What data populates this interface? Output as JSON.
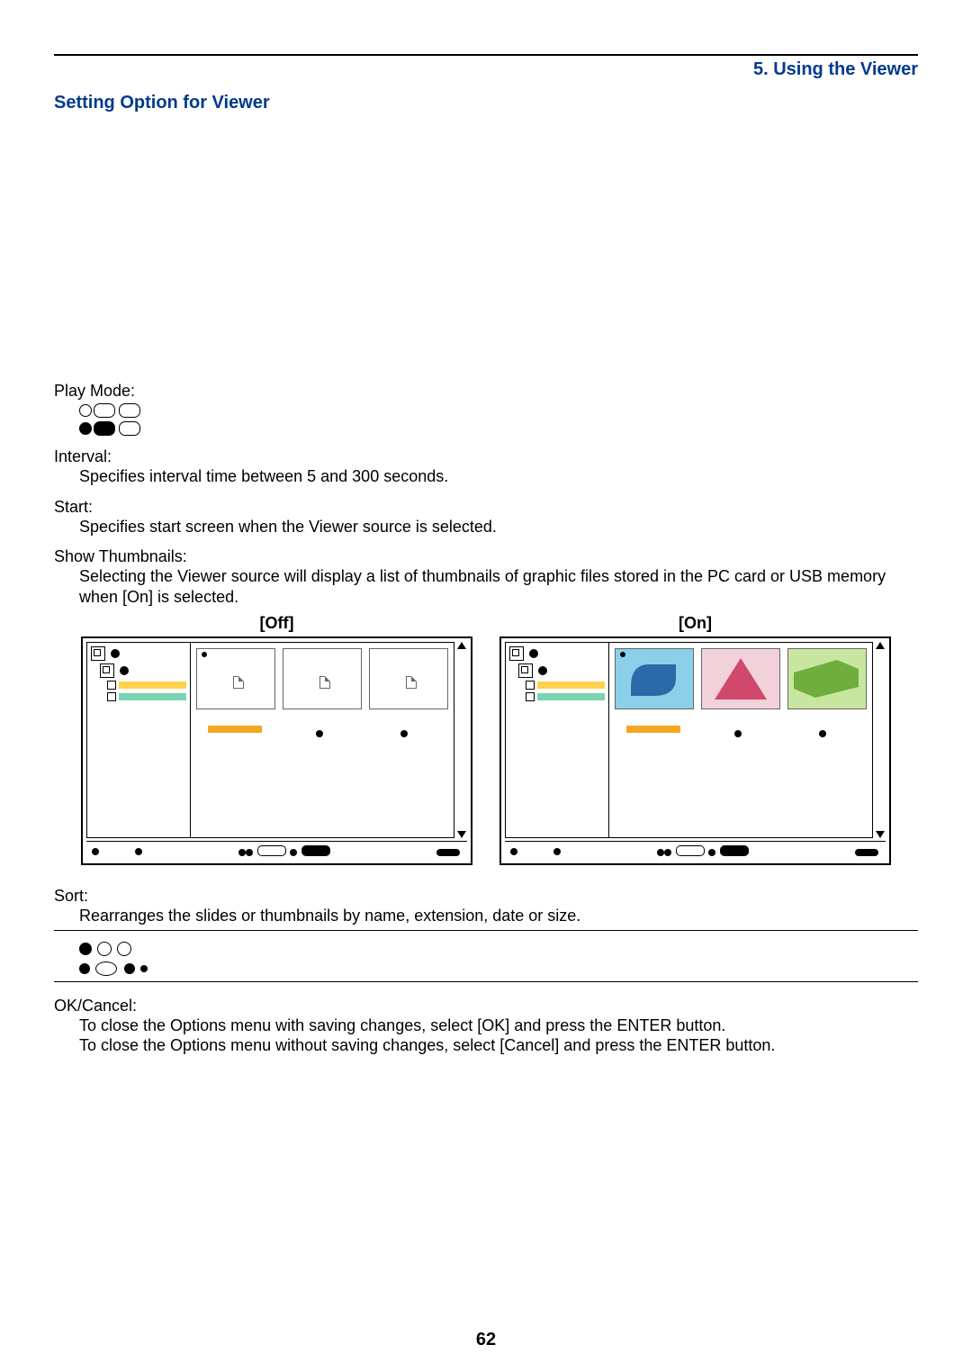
{
  "header": {
    "chapter": "5. Using the Viewer"
  },
  "section": {
    "title": "Setting Option for Viewer"
  },
  "play_mode": {
    "term": "Play Mode:"
  },
  "interval": {
    "term": "Interval:",
    "desc": "Specifies interval time between 5 and 300 seconds."
  },
  "start": {
    "term": "Start:",
    "desc": "Specifies start screen when the Viewer source is selected."
  },
  "show_thumbnails": {
    "term": "Show Thumbnails:",
    "desc": "Selecting the Viewer source will display a list of thumbnails of graphic files stored in the PC card or USB memory when [On] is selected."
  },
  "figures": {
    "off_label": "[Off]",
    "on_label": "[On]"
  },
  "sort": {
    "term": "Sort:",
    "desc": "Rearranges the slides or thumbnails by name, extension, date or size."
  },
  "ok_cancel": {
    "term": "OK/Cancel:",
    "line1": "To close the Options menu with saving changes, select [OK] and press the ENTER button.",
    "line2": "To close the Options menu without saving changes, select [Cancel] and press the ENTER button."
  },
  "page_number": "62"
}
